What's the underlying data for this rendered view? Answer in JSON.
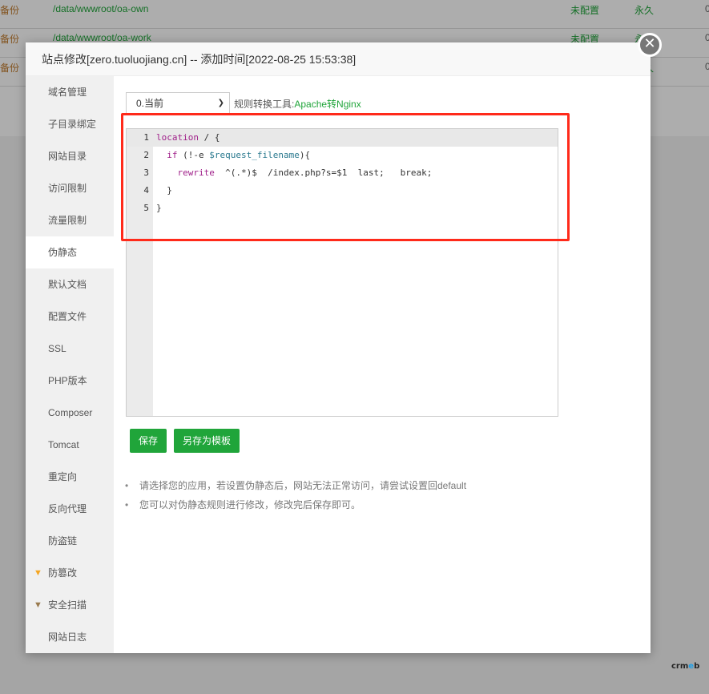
{
  "background_table": {
    "rows": [
      {
        "backup": "备份",
        "path": "/data/wwwroot/oa-own",
        "status": "未配置",
        "expire": "永久",
        "extra": "0"
      },
      {
        "backup": "备份",
        "path": "/data/wwwroot/oa-work",
        "status": "未配置",
        "expire": "永久",
        "extra": "0"
      },
      {
        "backup": "备份",
        "path": "",
        "status": "",
        "expire": "永久",
        "extra": "0"
      }
    ]
  },
  "dialog": {
    "title": "站点修改[zero.tuoluojiang.cn] -- 添加时间[2022-08-25 15:53:38]",
    "close_icon": "✕"
  },
  "sidebar": {
    "items": [
      {
        "label": "域名管理",
        "active": false,
        "icon": ""
      },
      {
        "label": "子目录绑定",
        "active": false,
        "icon": ""
      },
      {
        "label": "网站目录",
        "active": false,
        "icon": ""
      },
      {
        "label": "访问限制",
        "active": false,
        "icon": ""
      },
      {
        "label": "流量限制",
        "active": false,
        "icon": ""
      },
      {
        "label": "伪静态",
        "active": true,
        "icon": ""
      },
      {
        "label": "默认文档",
        "active": false,
        "icon": ""
      },
      {
        "label": "配置文件",
        "active": false,
        "icon": ""
      },
      {
        "label": "SSL",
        "active": false,
        "icon": ""
      },
      {
        "label": "PHP版本",
        "active": false,
        "icon": ""
      },
      {
        "label": "Composer",
        "active": false,
        "icon": ""
      },
      {
        "label": "Tomcat",
        "active": false,
        "icon": ""
      },
      {
        "label": "重定向",
        "active": false,
        "icon": ""
      },
      {
        "label": "反向代理",
        "active": false,
        "icon": ""
      },
      {
        "label": "防盗链",
        "active": false,
        "icon": ""
      },
      {
        "label": "防篡改",
        "active": false,
        "icon": "gem-gold-icon"
      },
      {
        "label": "安全扫描",
        "active": false,
        "icon": "gem-bronze-icon"
      },
      {
        "label": "网站日志",
        "active": false,
        "icon": ""
      }
    ]
  },
  "rewrite": {
    "template_select": "0.当前",
    "tool_label": "规则转换工具:",
    "tool_link": "Apache转Nginx",
    "code_lines": [
      {
        "num": "1",
        "text": "location / {"
      },
      {
        "num": "2",
        "text": "  if (!-e $request_filename){"
      },
      {
        "num": "3",
        "text": "    rewrite  ^(.*)$  /index.php?s=$1  last;   break;"
      },
      {
        "num": "4",
        "text": "  }"
      },
      {
        "num": "5",
        "text": "}"
      }
    ],
    "save_label": "保存",
    "save_template_label": "另存为模板",
    "tips": [
      "请选择您的应用，若设置伪静态后，网站无法正常访问，请尝试设置回default",
      "您可以对伪静态规则进行修改，修改完后保存即可。"
    ]
  },
  "colors": {
    "accent": "#20a53a",
    "highlight": "#ff2a1a",
    "keyword": "#a0218a",
    "variable": "#2b7a8f"
  },
  "watermark": {
    "pre": "crm",
    "mid": "e",
    "post": "b"
  }
}
